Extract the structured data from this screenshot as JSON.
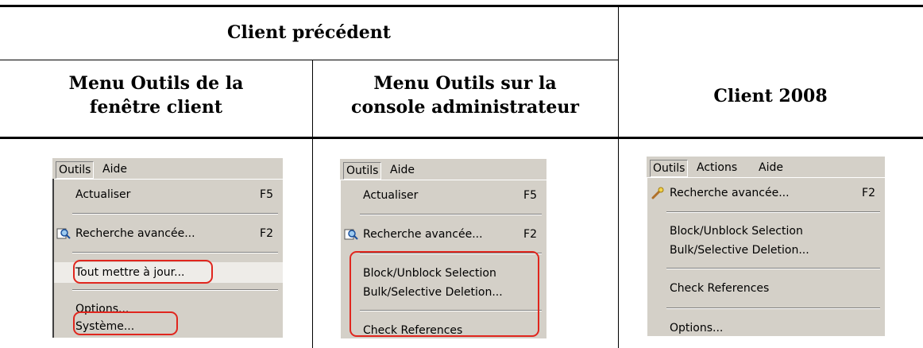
{
  "headers": {
    "previous_client": "Client précédent",
    "col1_line1": "Menu Outils de la",
    "col1_line2": "fenêtre client",
    "col2_line1": "Menu Outils sur la",
    "col2_line2": "console administrateur",
    "client_2008": "Client 2008"
  },
  "menu1": {
    "bar": [
      "Outils",
      "Aide"
    ],
    "items": {
      "actualiser": "Actualiser",
      "actualiser_sc": "F5",
      "recherche": "Recherche avancée...",
      "recherche_sc": "F2",
      "tout": "Tout mettre à jour...",
      "options": "Options...",
      "systeme": "Système..."
    }
  },
  "menu2": {
    "bar": [
      "Outils",
      "Aide"
    ],
    "items": {
      "actualiser": "Actualiser",
      "actualiser_sc": "F5",
      "recherche": "Recherche avancée...",
      "recherche_sc": "F2",
      "block": "Block/Unblock Selection",
      "bulk": "Bulk/Selective Deletion...",
      "check": "Check References"
    }
  },
  "menu3": {
    "bar": [
      "Outils",
      "Actions",
      "Aide"
    ],
    "items": {
      "recherche": "Recherche avancée...",
      "recherche_sc": "F2",
      "block": "Block/Unblock Selection",
      "bulk": "Bulk/Selective Deletion...",
      "check": "Check References",
      "options": "Options..."
    }
  },
  "colors": {
    "highlight_box": "#e0261e",
    "menu_bg": "#d4d0c8"
  }
}
